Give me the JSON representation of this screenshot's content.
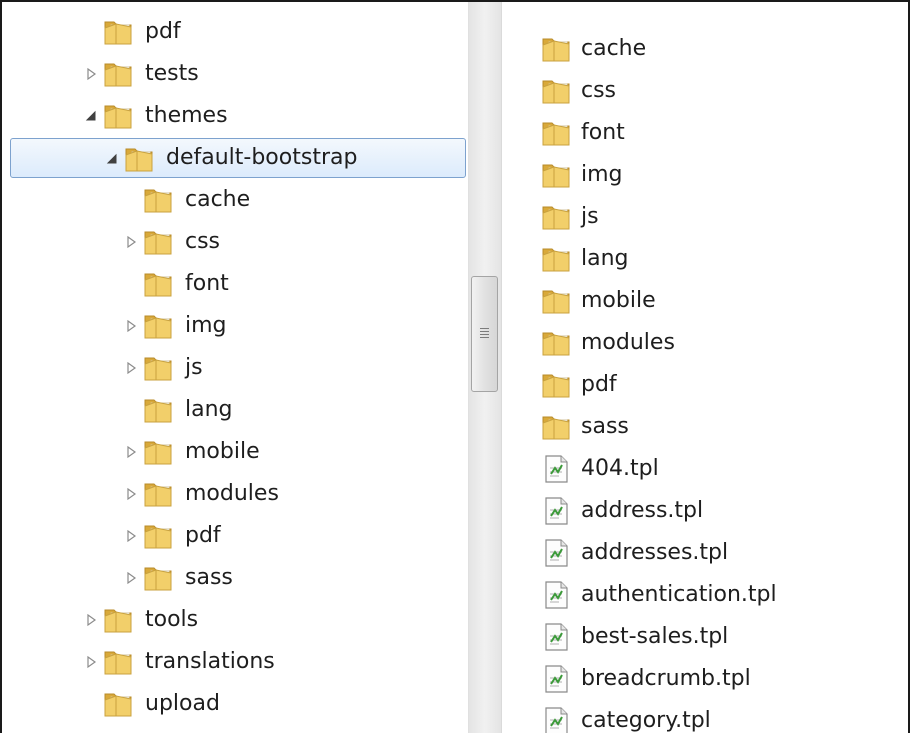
{
  "colors": {
    "folder_front": "#f2cf6a",
    "folder_back": "#d9a93a",
    "selection_border": "#7da2ce",
    "selection_fill": "#dcebfc"
  },
  "tree": {
    "items": [
      {
        "label": "pdf",
        "level": 1,
        "expander": "none"
      },
      {
        "label": "tests",
        "level": 1,
        "expander": "collapsed"
      },
      {
        "label": "themes",
        "level": 1,
        "expander": "expanded"
      },
      {
        "label": "default-bootstrap",
        "level": 2,
        "expander": "expanded",
        "selected": true
      },
      {
        "label": "cache",
        "level": 3,
        "expander": "none"
      },
      {
        "label": "css",
        "level": 3,
        "expander": "collapsed"
      },
      {
        "label": "font",
        "level": 3,
        "expander": "none"
      },
      {
        "label": "img",
        "level": 3,
        "expander": "collapsed"
      },
      {
        "label": "js",
        "level": 3,
        "expander": "collapsed"
      },
      {
        "label": "lang",
        "level": 3,
        "expander": "none"
      },
      {
        "label": "mobile",
        "level": 3,
        "expander": "collapsed"
      },
      {
        "label": "modules",
        "level": 3,
        "expander": "collapsed"
      },
      {
        "label": "pdf",
        "level": 3,
        "expander": "collapsed"
      },
      {
        "label": "sass",
        "level": 3,
        "expander": "collapsed"
      },
      {
        "label": "tools",
        "level": 1,
        "expander": "collapsed"
      },
      {
        "label": "translations",
        "level": 1,
        "expander": "collapsed"
      },
      {
        "label": "upload",
        "level": 1,
        "expander": "none"
      }
    ]
  },
  "files": {
    "items": [
      {
        "label": "cache",
        "type": "folder"
      },
      {
        "label": "css",
        "type": "folder"
      },
      {
        "label": "font",
        "type": "folder"
      },
      {
        "label": "img",
        "type": "folder"
      },
      {
        "label": "js",
        "type": "folder"
      },
      {
        "label": "lang",
        "type": "folder"
      },
      {
        "label": "mobile",
        "type": "folder"
      },
      {
        "label": "modules",
        "type": "folder"
      },
      {
        "label": "pdf",
        "type": "folder"
      },
      {
        "label": "sass",
        "type": "folder"
      },
      {
        "label": "404.tpl",
        "type": "file"
      },
      {
        "label": "address.tpl",
        "type": "file"
      },
      {
        "label": "addresses.tpl",
        "type": "file"
      },
      {
        "label": "authentication.tpl",
        "type": "file"
      },
      {
        "label": "best-sales.tpl",
        "type": "file"
      },
      {
        "label": "breadcrumb.tpl",
        "type": "file"
      },
      {
        "label": "category.tpl",
        "type": "file"
      }
    ]
  },
  "icons": {
    "folder": "folder-icon",
    "file": "tpl-file-icon",
    "collapsed": "expand-arrow-icon",
    "expanded": "collapse-arrow-icon",
    "grip": "scroll-grip-icon"
  }
}
